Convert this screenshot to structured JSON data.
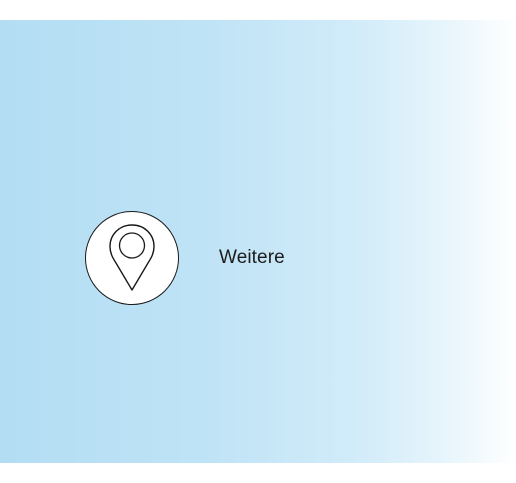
{
  "location_item": {
    "label": "Weitere",
    "icon": "map-pin-icon"
  },
  "colors": {
    "panel_gradient_start": "#b3ddf3",
    "panel_gradient_end": "#ffffff",
    "icon_stroke": "#1a1a1a",
    "text": "#1c1c1c"
  }
}
